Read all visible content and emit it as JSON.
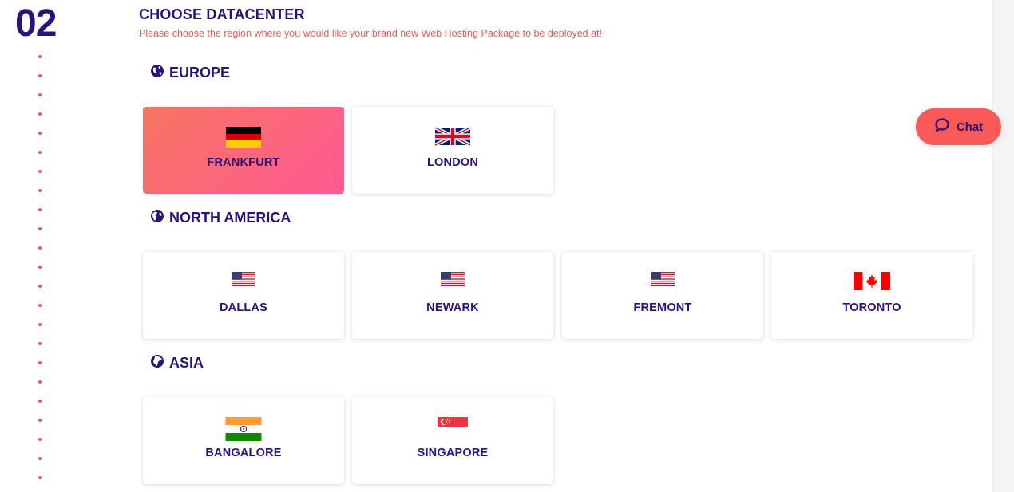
{
  "step": {
    "number": "02"
  },
  "section": {
    "title": "CHOOSE DATACENTER",
    "subtitle": "Please choose the region where you would like your brand new Web Hosting Package to be deployed at!"
  },
  "regions": [
    {
      "name": "EUROPE",
      "icon": "globe-europe-icon",
      "locations": [
        {
          "label": "FRANKFURT",
          "flag": "germany-flag",
          "selected": true
        },
        {
          "label": "LONDON",
          "flag": "uk-flag",
          "selected": false
        }
      ]
    },
    {
      "name": "NORTH AMERICA",
      "icon": "globe-americas-icon",
      "locations": [
        {
          "label": "DALLAS",
          "flag": "usa-flag",
          "selected": false
        },
        {
          "label": "NEWARK",
          "flag": "usa-flag",
          "selected": false
        },
        {
          "label": "FREMONT",
          "flag": "usa-flag",
          "selected": false
        },
        {
          "label": "TORONTO",
          "flag": "canada-flag",
          "selected": false
        }
      ]
    },
    {
      "name": "ASIA",
      "icon": "globe-asia-icon",
      "locations": [
        {
          "label": "BANGALORE",
          "flag": "india-flag",
          "selected": false
        },
        {
          "label": "SINGAPORE",
          "flag": "singapore-flag",
          "selected": false
        }
      ]
    }
  ],
  "chat": {
    "label": "Chat",
    "icon": "chat-bubble-icon"
  },
  "colors": {
    "primary": "#2b1278",
    "accent": "#f05a5a",
    "selected_gradient_start": "#f77560",
    "selected_gradient_end": "#ff5a93",
    "chat_button": "#f95a57"
  }
}
